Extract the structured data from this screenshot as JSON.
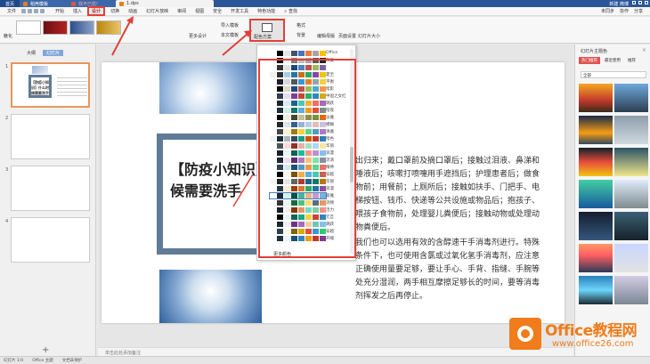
{
  "tabs": {
    "home": "首页",
    "t1": "稻壳模板",
    "t2": "找不已抗!",
    "doc": "1.dps",
    "user": "新建 微博"
  },
  "menu": {
    "file": "文件",
    "items": [
      "开始",
      "插入",
      "设计",
      "切换",
      "动画",
      "幻灯片放映",
      "审阅",
      "视图",
      "安全",
      "开发工具",
      "特色功能"
    ],
    "search": "查找",
    "right": [
      "未同步",
      "协作",
      "分享"
    ]
  },
  "ribbon": {
    "beautify": "魅化",
    "more_design": "更多设计",
    "import_tpl": "导入模板",
    "body_tpl": "本文模板",
    "format_label": "格式",
    "bg": "背景",
    "design": "配色方案",
    "edit_master": "编辑母版",
    "page_setup": "页面设置",
    "slide_size": "幻灯片大小"
  },
  "left": {
    "tab_outline": "大纲",
    "tab_slides": "幻灯片",
    "numbers": [
      "1",
      "2",
      "3",
      "4"
    ],
    "thumb_title": "【防疫小知识】什么时候需要洗手",
    "add": "+"
  },
  "slide": {
    "title": "【防疫小知识】什么时候需要洗手",
    "para1": "出归来；戴口罩前及摘口罩后；接触过泪液、鼻涕和唾液后；咳嗽打喷嚏用手遮挡后；护理患者后；做食物前；用餐前；上厕所后；接触如扶手、门把手、电梯按钮、钱币、快递等公共设施或物品后；抱孩子、喂孩子食物前，处理婴儿粪便后；接触动物或处理动物粪便后。",
    "para2": "我们也可以选用有效的含醇速干手消毒剂进行。特殊条件下，也可使用含氯或过氧化氢手消毒剂，应注意正确使用量要足够，要让手心、手背、指缝、手腕等处充分湿润，两手相互摩擦足够长的时间，要等消毒剂挥发之后再停止。"
  },
  "notes": "单击此处添加备注",
  "dropdown": {
    "header": "Office",
    "more": "更多颜色",
    "names": [
      "Office",
      "灰度",
      "",
      "夏至",
      "平衡",
      "暗影",
      "中国之女红",
      "跳跃",
      "暗夜",
      "淡雅",
      "模糊",
      "清雅",
      "暗色",
      "华丽",
      "浪漫",
      "流淌",
      "精神",
      "穿越",
      "华丽",
      "浪漫",
      "高雅",
      "流畅",
      "活力",
      "元旦",
      "跳跃",
      "穿越",
      "开端",
      "风格九天"
    ]
  },
  "right": {
    "title": "幻灯片主题色",
    "tabs": [
      "热门推荐",
      "最近使用",
      "推荐"
    ],
    "filter": "全部"
  },
  "status": {
    "slide_pos": "幻灯片 1/4",
    "theme": "Office 主题",
    "spell": "文档未保护"
  },
  "logo": {
    "name": "Office教程网",
    "url": "www.office26.com"
  },
  "colors": {
    "accent_red": "#e0403a",
    "brand_blue": "#2b579a",
    "frame": "#5f7b95",
    "logo_orange": "#f07c1b"
  }
}
